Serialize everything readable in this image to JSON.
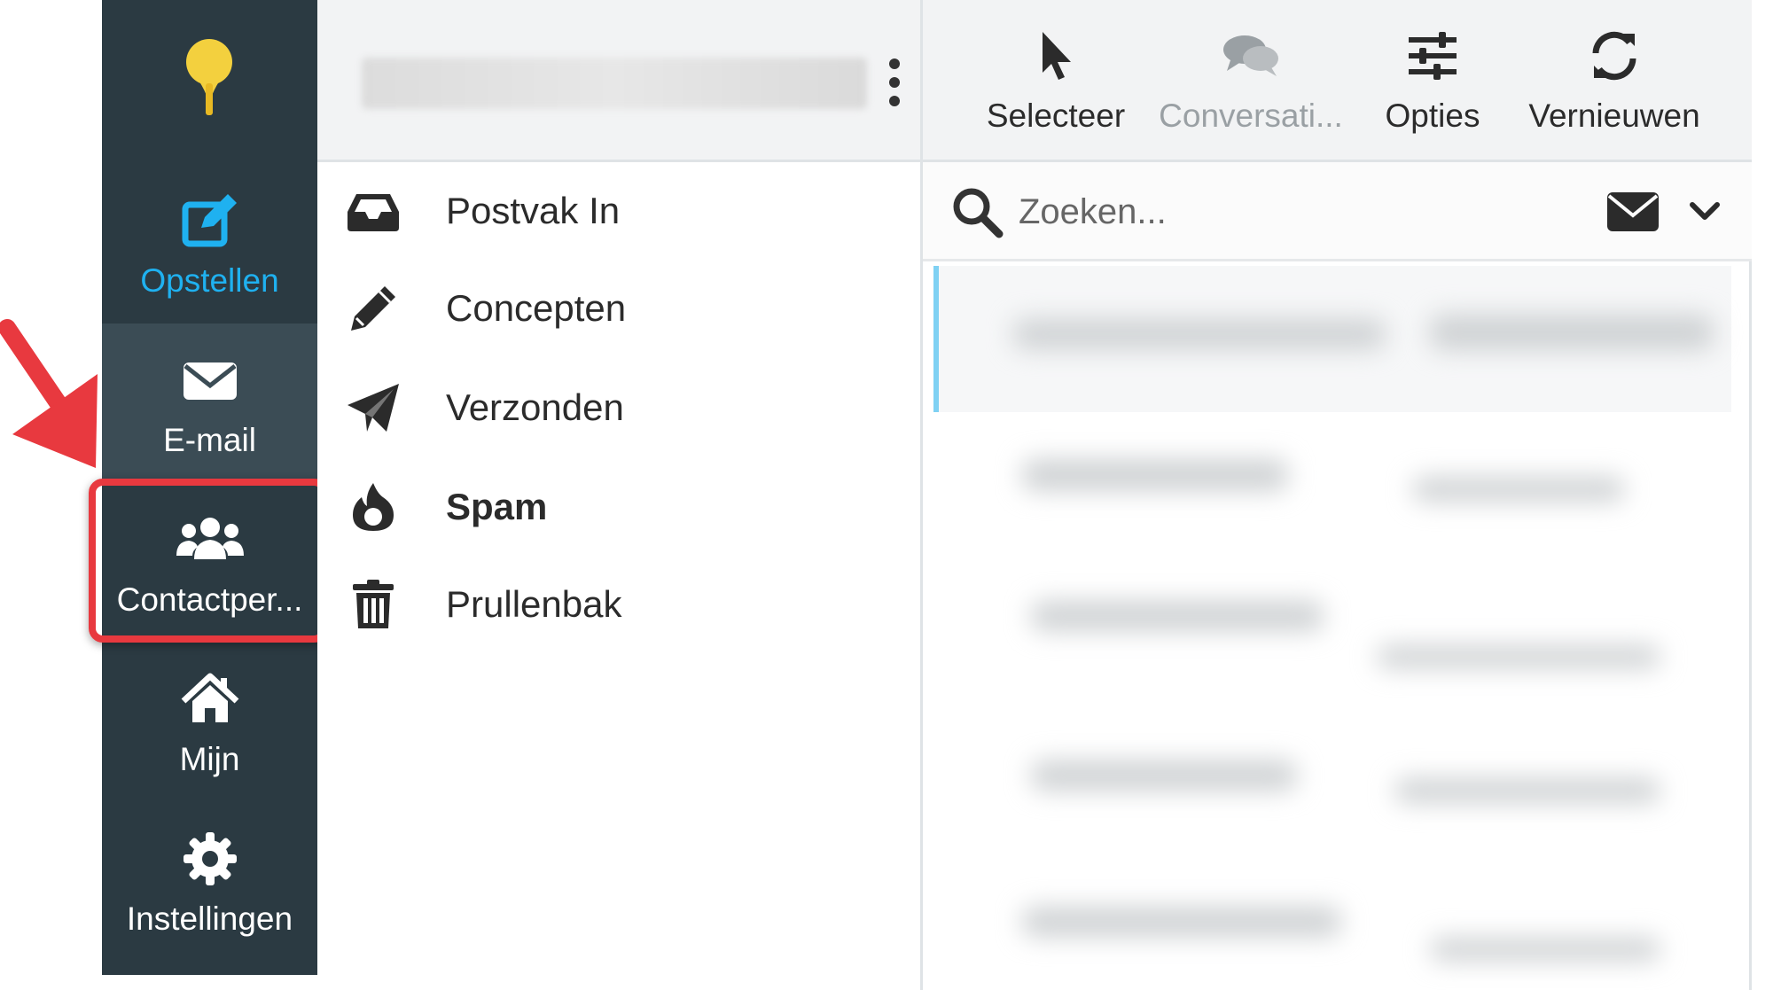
{
  "nav": {
    "logo_icon": "lightbulb-icon",
    "items": [
      {
        "label": "Opstellen",
        "icon": "compose-icon",
        "color": "#1fb1f0"
      },
      {
        "label": "E-mail",
        "icon": "envelope-icon"
      },
      {
        "label": "Contactper...",
        "icon": "users-icon"
      },
      {
        "label": "Mijn",
        "icon": "home-icon"
      },
      {
        "label": "Instellingen",
        "icon": "gear-icon"
      }
    ],
    "highlight_color": "#e8393f"
  },
  "folders": [
    {
      "label": "Postvak In",
      "icon": "inbox-icon"
    },
    {
      "label": "Concepten",
      "icon": "pencil-icon"
    },
    {
      "label": "Verzonden",
      "icon": "paper-plane-icon"
    },
    {
      "label": "Spam",
      "icon": "fire-icon"
    },
    {
      "label": "Prullenbak",
      "icon": "trash-icon"
    }
  ],
  "toolbar": {
    "select_label": "Selecteer",
    "conversation_label": "Conversati...",
    "options_label": "Opties",
    "refresh_label": "Vernieuwen"
  },
  "search": {
    "placeholder": "Zoeken..."
  },
  "colors": {
    "rail_bg": "#2b3a42",
    "accent": "#1fb1f0",
    "selection_bar": "#7fd1f3"
  }
}
